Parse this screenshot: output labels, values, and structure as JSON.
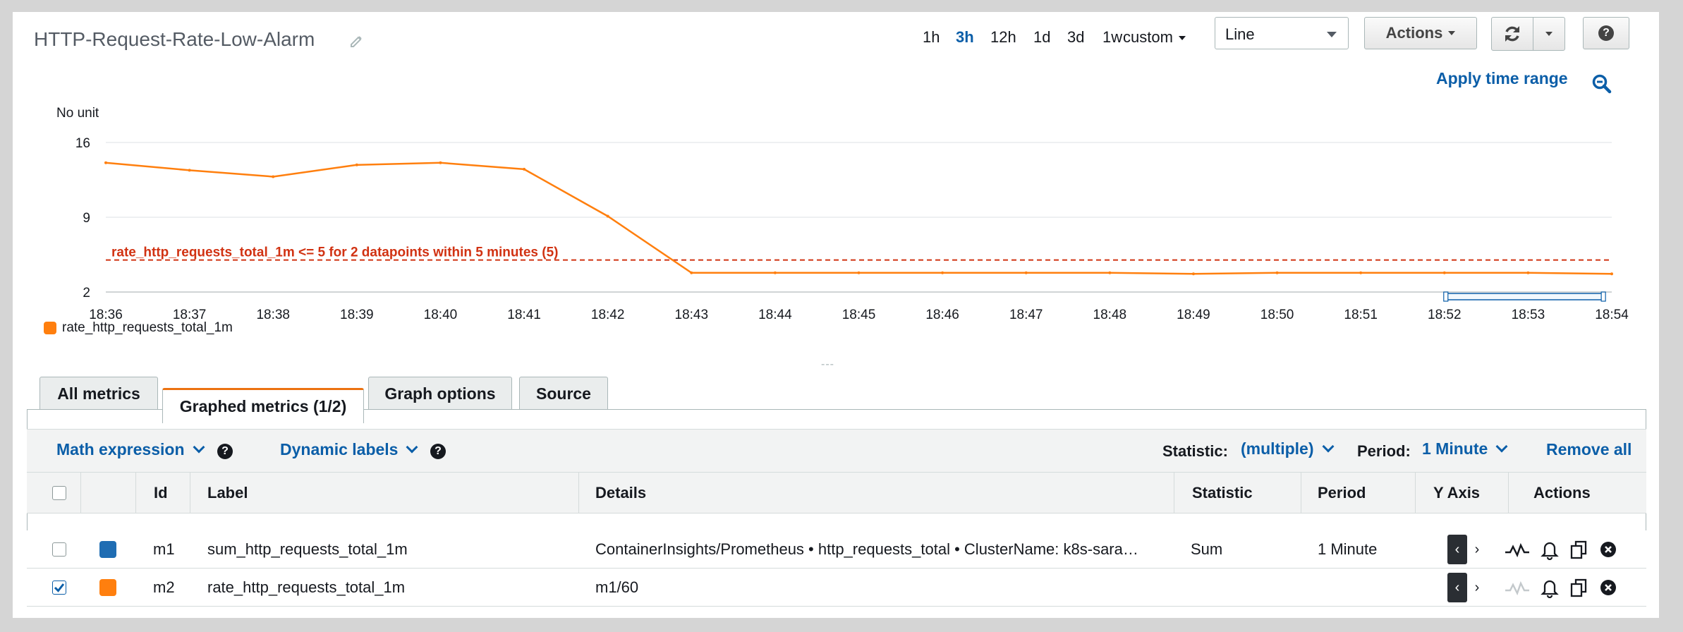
{
  "header": {
    "title": "HTTP-Request-Rate-Low-Alarm",
    "time_ranges": [
      "1h",
      "3h",
      "12h",
      "1d",
      "3d",
      "1w"
    ],
    "active_time_range": "3h",
    "custom_label": "custom",
    "view_type": "Line",
    "actions_label": "Actions",
    "help_label": "?",
    "apply_time_range": "Apply time range"
  },
  "chart_data": {
    "type": "line",
    "ylabel": "No unit",
    "yticks": [
      2,
      9,
      16
    ],
    "ylim": [
      2,
      16
    ],
    "x": [
      "18:36",
      "18:37",
      "18:38",
      "18:39",
      "18:40",
      "18:41",
      "18:42",
      "18:43",
      "18:44",
      "18:45",
      "18:46",
      "18:47",
      "18:48",
      "18:49",
      "18:50",
      "18:51",
      "18:52",
      "18:53",
      "18:54"
    ],
    "series": [
      {
        "name": "rate_http_requests_total_1m",
        "color": "#ff7f0e",
        "values": [
          14.1,
          13.4,
          12.8,
          13.9,
          14.1,
          13.5,
          9.1,
          3.8,
          3.8,
          3.8,
          3.8,
          3.8,
          3.8,
          3.7,
          3.8,
          3.8,
          3.8,
          3.8,
          3.7
        ]
      }
    ],
    "threshold": {
      "value": 5,
      "label": "rate_http_requests_total_1m <= 5 for 2 datapoints within 5 minutes (5)",
      "color": "#d13212"
    },
    "grid": true,
    "legend": "bottom-left"
  },
  "resize_handle": "---",
  "tabs": [
    {
      "label": "All metrics",
      "active": false
    },
    {
      "label": "Graphed metrics (1/2)",
      "active": true
    },
    {
      "label": "Graph options",
      "active": false
    },
    {
      "label": "Source",
      "active": false
    }
  ],
  "toolbar": {
    "math_expression": "Math expression",
    "dynamic_labels": "Dynamic labels",
    "statistic_label": "Statistic:",
    "statistic_value": "(multiple)",
    "period_label": "Period:",
    "period_value": "1 Minute",
    "remove_all": "Remove all"
  },
  "table": {
    "columns": [
      "Id",
      "Label",
      "Details",
      "Statistic",
      "Period",
      "Y Axis",
      "Actions"
    ],
    "rows": [
      {
        "checked": false,
        "color": "#1f6db3",
        "id": "m1",
        "label": "sum_http_requests_total_1m",
        "details": "ContainerInsights/Prometheus • http_requests_total • ClusterName: k8s-sara…",
        "statistic": "Sum",
        "period": "1 Minute"
      },
      {
        "checked": true,
        "color": "#ff7f0e",
        "id": "m2",
        "label": "rate_http_requests_total_1m",
        "details": "m1/60",
        "statistic": "",
        "period": ""
      }
    ]
  }
}
